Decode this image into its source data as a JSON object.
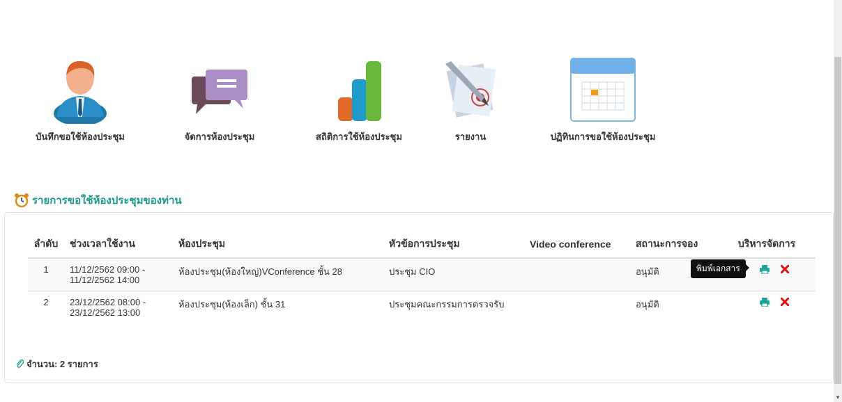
{
  "menu": {
    "items": [
      {
        "label": "บันทึกขอใช้ห้องประชุม",
        "icon": "user-icon"
      },
      {
        "label": "จัดการห้องประชุม",
        "icon": "chat-icon"
      },
      {
        "label": "สถิติการใช้ห้องประชุม",
        "icon": "bar-chart-icon"
      },
      {
        "label": "รายงาน",
        "icon": "document-icon"
      },
      {
        "label": "ปฏิทินการขอใช้ห้องประชุม",
        "icon": "calendar-icon"
      }
    ]
  },
  "section": {
    "title": "รายการขอใช้ห้องประชุมของท่าน",
    "icon": "alarm-clock-icon"
  },
  "table": {
    "headers": [
      "ลำดับ",
      "ช่วงเวลาใช้งาน",
      "ห้องประชุม",
      "หัวข้อการประชุม",
      "Video conference",
      "สถานะการจอง",
      "บริหารจัดการ"
    ],
    "rows": [
      {
        "no": "1",
        "time_start": "11/12/2562 09:00 -",
        "time_end": "11/12/2562 14:00",
        "room": "ห้องประชุม(ห้องใหญ่)VConference ชั้น 28",
        "topic": "ประชุม CIO",
        "video": "",
        "status": "อนุมัติ"
      },
      {
        "no": "2",
        "time_start": "23/12/2562 08:00 -",
        "time_end": "23/12/2562 13:00",
        "room": "ห้องประชุม(ห้องเล็ก) ชั้น 31",
        "topic": "ประชุมคณะกรรมการตรวจรับ",
        "video": "",
        "status": "อนุมัติ"
      }
    ]
  },
  "tooltip": {
    "text": "พิมพ์เอกสาร"
  },
  "footer": {
    "count_label": "จำนวน: 2 รายการ"
  },
  "colors": {
    "accent": "#1a9a8b",
    "print": "#1aa59a",
    "delete": "#e01010"
  }
}
